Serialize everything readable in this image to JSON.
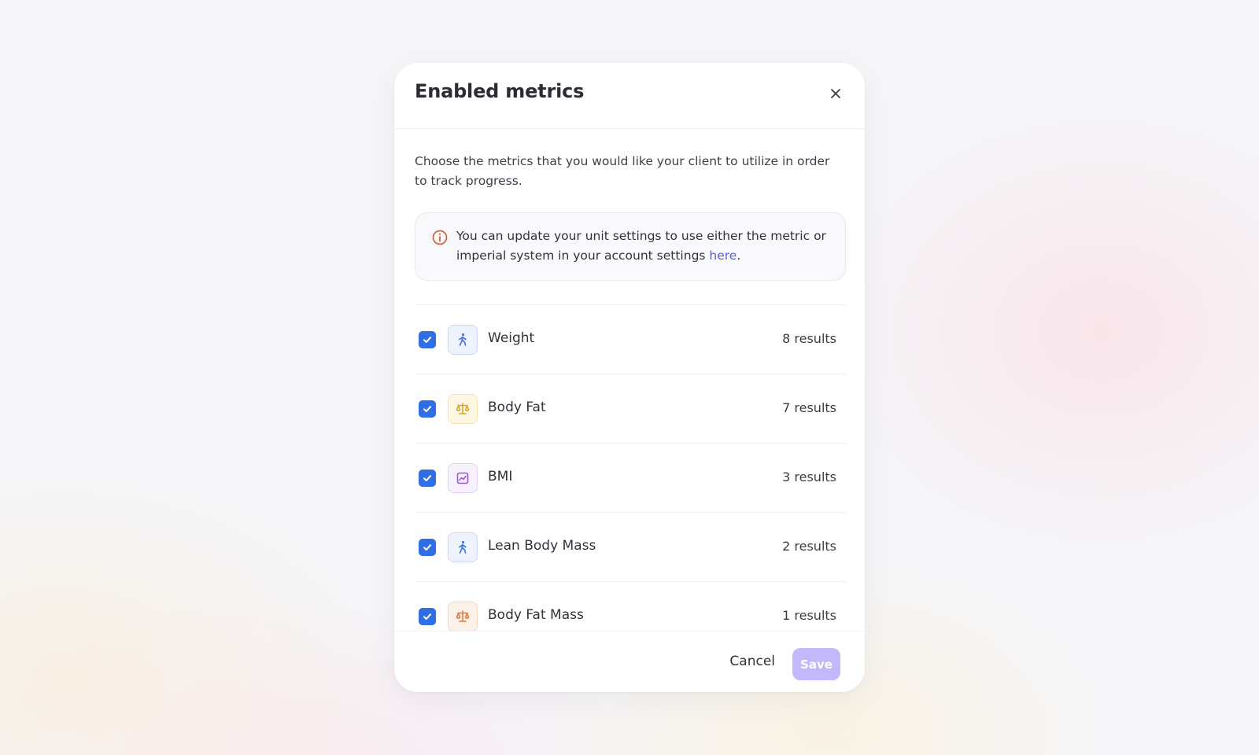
{
  "modal": {
    "title": "Enabled metrics",
    "description": "Choose the metrics that you would like your client to utilize in order to track progress.",
    "info": {
      "text_before": "You can update your unit settings to use either the metric or imperial system in your account settings ",
      "link_text": "here",
      "text_after": "."
    }
  },
  "metrics": [
    {
      "name": "Weight",
      "count": "8 results",
      "icon": "walking-person-icon",
      "checked": true,
      "icon_color": "#4a78d6",
      "icon_bg": "#eef3fd",
      "icon_border": "#c9d8f5"
    },
    {
      "name": "Body Fat",
      "count": "7 results",
      "icon": "scale-balance-icon",
      "checked": true,
      "icon_color": "#d9a62e",
      "icon_bg": "#fdf7e4",
      "icon_border": "#f5e3ad"
    },
    {
      "name": "BMI",
      "count": "3 results",
      "icon": "chart-icon",
      "checked": true,
      "icon_color": "#9a5bd2",
      "icon_bg": "#f7f0fd",
      "icon_border": "#e2cff5"
    },
    {
      "name": "Lean Body Mass",
      "count": "2 results",
      "icon": "walking-person-icon",
      "checked": true,
      "icon_color": "#4a78d6",
      "icon_bg": "#eef3fd",
      "icon_border": "#c9d8f5"
    },
    {
      "name": "Body Fat Mass",
      "count": "1 results",
      "icon": "scale-balance-icon",
      "checked": true,
      "icon_color": "#e57b3a",
      "icon_bg": "#fdf1e8",
      "icon_border": "#f5d4bd"
    }
  ],
  "footer": {
    "cancel_label": "Cancel",
    "save_label": "Save"
  },
  "colors": {
    "accent": "#2f6fe3",
    "link": "#5a5ce0",
    "save_disabled": "#c2b8fb",
    "info_icon": "#d0633a"
  }
}
